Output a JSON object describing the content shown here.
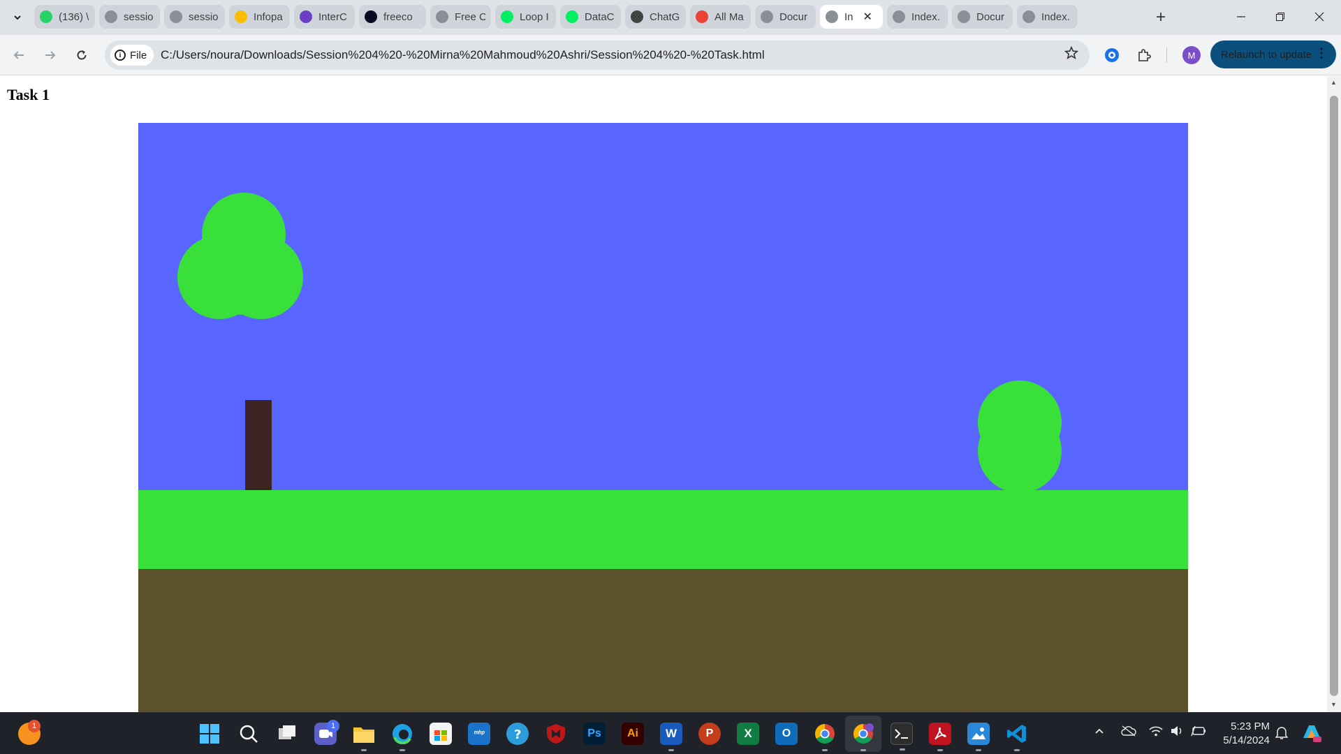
{
  "browser": {
    "tabs": [
      {
        "title": "(136) \\",
        "favicon": "whatsapp-icon",
        "color": "#25d366"
      },
      {
        "title": "sessio",
        "favicon": "globe-icon",
        "color": "#8a8f95"
      },
      {
        "title": "sessio",
        "favicon": "globe-icon",
        "color": "#8a8f95"
      },
      {
        "title": "Infopa",
        "favicon": "google-drive-icon",
        "color": "#fbbc04"
      },
      {
        "title": "InterC",
        "favicon": "list-icon",
        "color": "#6a3fc4"
      },
      {
        "title": "freeco",
        "favicon": "freecodecamp-icon",
        "color": "#0a0a23"
      },
      {
        "title": "Free C",
        "favicon": "globe-icon",
        "color": "#8a8f95"
      },
      {
        "title": "Loop I",
        "favicon": "datacamp-icon",
        "color": "#03ef62"
      },
      {
        "title": "DataC",
        "favicon": "datacamp-icon",
        "color": "#03ef62"
      },
      {
        "title": "ChatG",
        "favicon": "chatgpt-icon",
        "color": "#444444"
      },
      {
        "title": "All Ma",
        "favicon": "gmail-icon",
        "color": "#ea4335"
      },
      {
        "title": "Docur",
        "favicon": "globe-icon",
        "color": "#8a8f95"
      },
      {
        "title": "In",
        "favicon": "globe-icon",
        "color": "#8a8f95",
        "active": true
      },
      {
        "title": "Index.",
        "favicon": "globe-icon",
        "color": "#8a8f95"
      },
      {
        "title": "Docur",
        "favicon": "globe-icon",
        "color": "#8a8f95"
      },
      {
        "title": "Index.",
        "favicon": "globe-icon",
        "color": "#8a8f95"
      }
    ],
    "site_chip_label": "File",
    "url": "C:/Users/noura/Downloads/Session%204%20-%20Mirna%20Mahmoud%20Ashri/Session%204%20-%20Task.html",
    "avatar_letter": "M",
    "relaunch_label": "Relaunch to update"
  },
  "page": {
    "heading": "Task 1"
  },
  "scene": {
    "sky_color": "#5865ff",
    "grass_color": "#39e03a",
    "soil_color": "#5d502c",
    "trunk_color": "#3e2323",
    "leaf_color": "#39e03a"
  },
  "taskbar": {
    "notification_badge": "1",
    "chat_badge": "1",
    "time": "5:23 PM",
    "date": "5/14/2024"
  }
}
